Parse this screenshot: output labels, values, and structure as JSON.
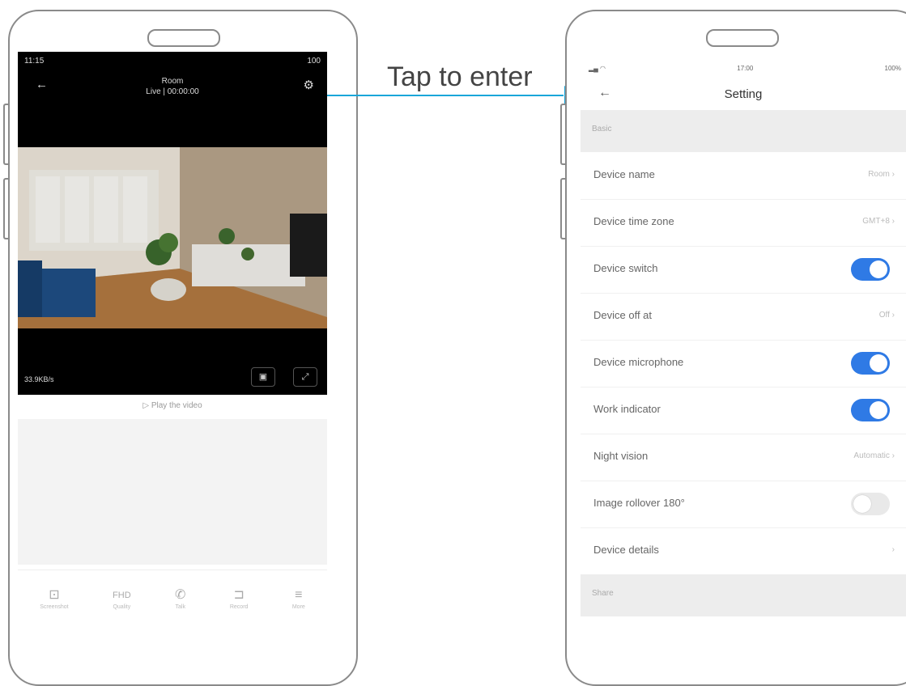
{
  "callout": {
    "text": "Tap to enter"
  },
  "live_view": {
    "status_time": "11:15",
    "status_battery": "100",
    "device_name": "Room",
    "subtitle": "Live | 00:00:00",
    "back_icon": "back-arrow-icon",
    "settings_icon": "gear-icon",
    "speed": "33.9KB/s",
    "play_hint": "Play the video",
    "toolbar": [
      {
        "icon": "screenshot-icon",
        "label": "Screenshot"
      },
      {
        "icon": "hd-icon",
        "label": "Quality"
      },
      {
        "icon": "phone-icon",
        "label": "Talk"
      },
      {
        "icon": "record-icon",
        "label": "Record"
      },
      {
        "icon": "more-icon",
        "label": "More"
      }
    ],
    "toolbar_glyphs": [
      "⊡",
      "FHD",
      "✆",
      "⊐",
      "≡"
    ]
  },
  "settings": {
    "status_time": "17:00",
    "status_right": "100%",
    "title": "Setting",
    "back_icon": "back-arrow-icon",
    "section_1": "Basic",
    "section_2": "Share",
    "rows": [
      {
        "label": "Device name",
        "value": "Room"
      },
      {
        "label": "Device time zone",
        "value": "GMT+8"
      },
      {
        "label": "Device switch",
        "toggle": true
      },
      {
        "label": "Device off at",
        "value": "Off"
      },
      {
        "label": "Device microphone",
        "toggle": true
      },
      {
        "label": "Work indicator",
        "toggle": true
      },
      {
        "label": "Night vision",
        "value": "Automatic"
      },
      {
        "label": "Image rollover 180°",
        "toggle": false
      },
      {
        "label": "Device details",
        "value": ""
      }
    ]
  },
  "colors": {
    "accent": "#2f7ae5",
    "callout_arrow": "#1aa6d9"
  }
}
